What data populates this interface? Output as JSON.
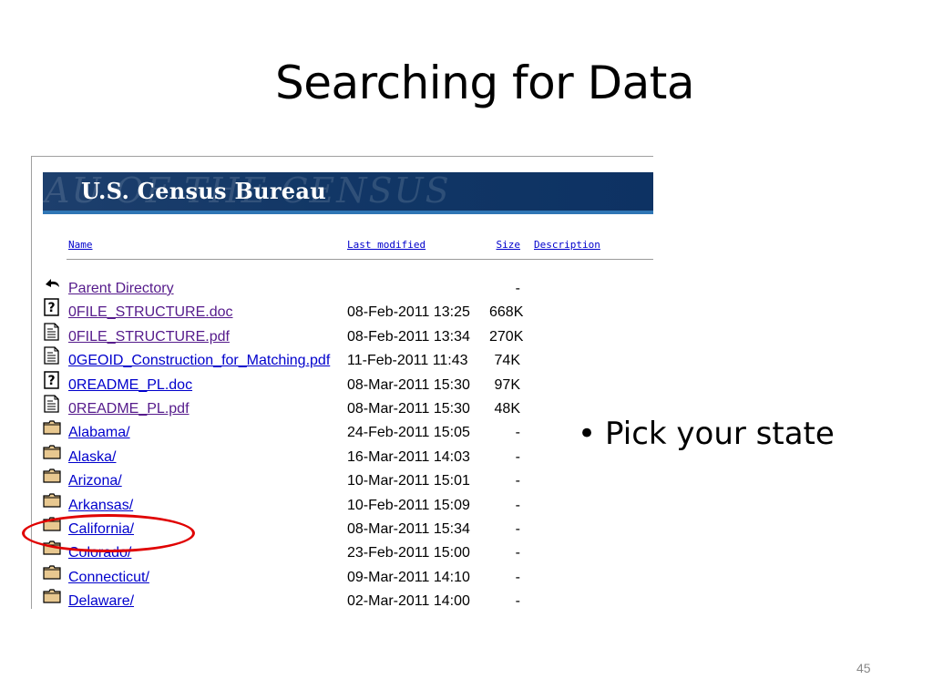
{
  "slide": {
    "title": "Searching for Data",
    "bullet": "Pick your state",
    "page_number": "45"
  },
  "census": {
    "banner_title": "U.S. Census Bureau",
    "banner_watermark": "AU OF THE CENSUS",
    "columns": {
      "name": "Name",
      "last_modified": "Last modified",
      "size": "Size",
      "description": "Description"
    },
    "rows": [
      {
        "icon": "back-arrow-icon",
        "name": "Parent Directory",
        "date": "",
        "size": "-",
        "visited": true
      },
      {
        "icon": "unknown-file-icon",
        "name": "0FILE_STRUCTURE.doc",
        "date": "08-Feb-2011 13:25",
        "size": "668K",
        "visited": true
      },
      {
        "icon": "text-file-icon",
        "name": "0FILE_STRUCTURE.pdf",
        "date": "08-Feb-2011 13:34",
        "size": "270K",
        "visited": true
      },
      {
        "icon": "text-file-icon",
        "name": "0GEOID_Construction_for_Matching.pdf",
        "date": "11-Feb-2011 11:43",
        "size": "74K",
        "visited": false
      },
      {
        "icon": "unknown-file-icon",
        "name": "0README_PL.doc",
        "date": "08-Mar-2011 15:30",
        "size": "97K",
        "visited": false
      },
      {
        "icon": "text-file-icon",
        "name": "0README_PL.pdf",
        "date": "08-Mar-2011 15:30",
        "size": "48K",
        "visited": true
      },
      {
        "icon": "folder-icon",
        "name": "Alabama/",
        "date": "24-Feb-2011 15:05",
        "size": "-",
        "visited": false
      },
      {
        "icon": "folder-icon",
        "name": "Alaska/",
        "date": "16-Mar-2011 14:03",
        "size": "-",
        "visited": false
      },
      {
        "icon": "folder-icon",
        "name": "Arizona/",
        "date": "10-Mar-2011 15:01",
        "size": "-",
        "visited": false
      },
      {
        "icon": "folder-icon",
        "name": "Arkansas/",
        "date": "10-Feb-2011 15:09",
        "size": "-",
        "visited": false
      },
      {
        "icon": "folder-icon",
        "name": "California/",
        "date": "08-Mar-2011 15:34",
        "size": "-",
        "visited": false
      },
      {
        "icon": "folder-icon",
        "name": "Colorado/",
        "date": "23-Feb-2011 15:00",
        "size": "-",
        "visited": false
      },
      {
        "icon": "folder-icon",
        "name": "Connecticut/",
        "date": "09-Mar-2011 14:10",
        "size": "-",
        "visited": false
      },
      {
        "icon": "folder-icon",
        "name": "Delaware/",
        "date": "02-Mar-2011 14:00",
        "size": "-",
        "visited": false
      }
    ]
  },
  "colors": {
    "banner_bg": "#123766",
    "banner_rule": "#2f76b5",
    "link": "#0000cc",
    "visited_link": "#551a8b",
    "highlight_circle": "#e00000"
  }
}
